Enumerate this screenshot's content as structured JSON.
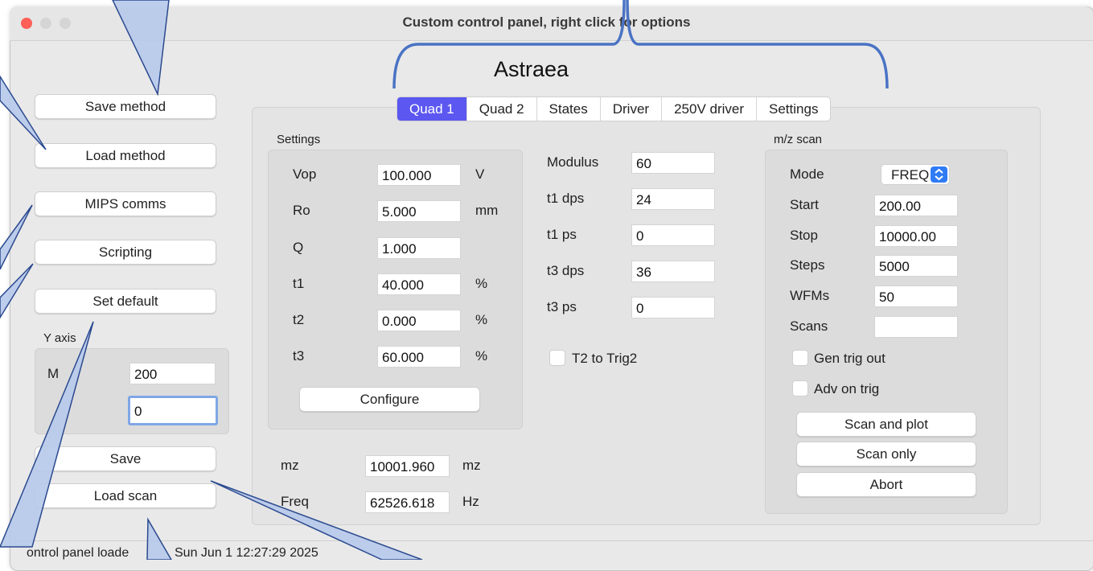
{
  "window": {
    "title": "Custom control panel, right click for options"
  },
  "panel_title": "Astraea",
  "left_buttons": {
    "save_method": "Save method",
    "load_method": "Load method",
    "mips_comms": "MIPS comms",
    "scripting": "Scripting",
    "set_default": "Set default",
    "save": "Save",
    "load_scan": "Load scan"
  },
  "y_axis": {
    "group_label": "Y axis",
    "max_label": "M",
    "max_value": "200",
    "min_value": "0"
  },
  "tabs": [
    "Quad 1",
    "Quad 2",
    "States",
    "Driver",
    "250V driver",
    "Settings"
  ],
  "settings": {
    "group_label": "Settings",
    "rows": [
      {
        "label": "Vop",
        "value": "100.000",
        "unit": "V"
      },
      {
        "label": "Ro",
        "value": "5.000",
        "unit": "mm"
      },
      {
        "label": "Q",
        "value": "1.000",
        "unit": ""
      },
      {
        "label": "t1",
        "value": "40.000",
        "unit": "%"
      },
      {
        "label": "t2",
        "value": "0.000",
        "unit": "%"
      },
      {
        "label": "t3",
        "value": "60.000",
        "unit": "%"
      }
    ],
    "configure_button": "Configure"
  },
  "mz_freq": {
    "mz_label": "mz",
    "mz_value": "10001.960",
    "mz_unit": "mz",
    "freq_label": "Freq",
    "freq_value": "62526.618",
    "freq_unit": "Hz"
  },
  "modulus": {
    "rows": [
      {
        "label": "Modulus",
        "value": "60"
      },
      {
        "label": "t1 dps",
        "value": "24"
      },
      {
        "label": "t1 ps",
        "value": "0"
      },
      {
        "label": "t3 dps",
        "value": "36"
      },
      {
        "label": "t3 ps",
        "value": "0"
      }
    ],
    "t2_to_trig2": "T2 to Trig2"
  },
  "mz_scan": {
    "group_label": "m/z scan",
    "mode_label": "Mode",
    "mode_value": "FREQ",
    "rows": [
      {
        "label": "Start",
        "value": "200.00"
      },
      {
        "label": "Stop",
        "value": "10000.00"
      },
      {
        "label": "Steps",
        "value": "5000"
      },
      {
        "label": "WFMs",
        "value": "50"
      },
      {
        "label": "Scans",
        "value": ""
      }
    ],
    "gen_trig_out": "Gen trig out",
    "adv_on_trig": "Adv on trig",
    "scan_and_plot": "Scan and plot",
    "scan_only": "Scan only",
    "abort": "Abort"
  },
  "status": {
    "text": "ontrol panel loade",
    "time": "Sun Jun 1 12:27:29 2025"
  },
  "colors": {
    "active_tab": "#5b57f0",
    "callout_fill": "#b7c9ea",
    "callout_stroke": "#2b4a8f",
    "bracket": "#4a73c4"
  }
}
